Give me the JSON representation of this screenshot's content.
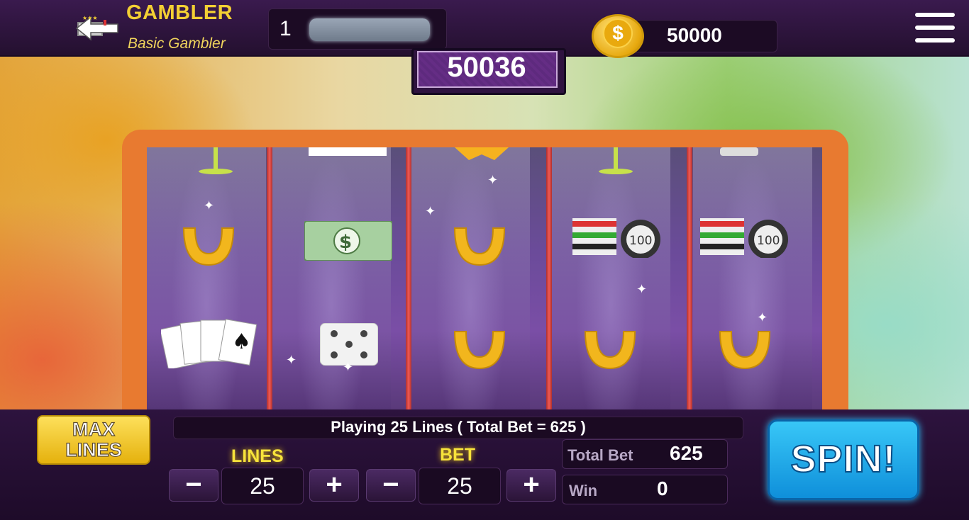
{
  "header": {
    "back_icon": "back-arrow-icon",
    "title": "GAMBLER",
    "subtitle": "Basic Gambler",
    "level": "1",
    "coin_icon": "dollar-coin-icon",
    "coin_symbol": "$",
    "coins": "50000",
    "menu_icon": "hamburger-menu-icon"
  },
  "jackpot": "50036",
  "reels": [
    [
      "martini-glass",
      "horseshoe",
      "playing-cards"
    ],
    [
      "playing-cards",
      "dollar-bill",
      "dice"
    ],
    [
      "star",
      "horseshoe",
      "horseshoe"
    ],
    [
      "martini-glass",
      "poker-chips",
      "horseshoe"
    ],
    [
      "dice",
      "poker-chips",
      "horseshoe"
    ]
  ],
  "controls": {
    "max_lines_line1": "MAX",
    "max_lines_line2": "LINES",
    "info_text": "Playing 25 Lines ( Total Bet = 625 )",
    "lines_label": "LINES",
    "lines_value": "25",
    "bet_label": "BET",
    "bet_value": "25",
    "minus": "−",
    "plus": "+",
    "total_bet_label": "Total Bet",
    "total_bet_value": "625",
    "win_label": "Win",
    "win_value": "0",
    "spin_label": "SPIN!"
  },
  "colors": {
    "gold": "#f3cf33",
    "spin_blue": "#1ea7e8",
    "frame_orange": "#e87a30",
    "reel_separator": "#e64a45"
  }
}
